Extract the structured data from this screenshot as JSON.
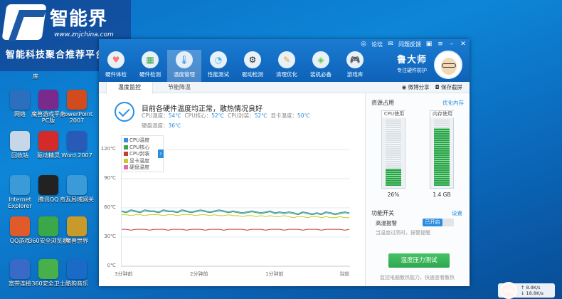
{
  "banner": {
    "brand": "智能界",
    "url": "www.znjchina.com",
    "slogan": "智能科技聚合推荐平台"
  },
  "desktop": {
    "partial_label": "库",
    "icons": [
      {
        "label": "网络",
        "color": "#2d6fbf"
      },
      {
        "label": "魔兽游戏平台PC版",
        "color": "#7a2a8c"
      },
      {
        "label": "PowerPoint 2007",
        "color": "#d24b1e"
      },
      {
        "label": "回收站",
        "color": "#c8d7e8"
      },
      {
        "label": "驱动精灵",
        "color": "#d42a2a"
      },
      {
        "label": "Word 2007",
        "color": "#2a5ab8"
      },
      {
        "label": "Internet Explorer",
        "color": "#3a9bd8"
      },
      {
        "label": "腾讯QQ",
        "color": "#222222"
      },
      {
        "label": "奇瓦局域网关",
        "color": "#3a9bd8"
      },
      {
        "label": "QQ游戏",
        "color": "#e05a2a"
      },
      {
        "label": "360安全浏览器",
        "color": "#3aa848"
      },
      {
        "label": "魔兽世界",
        "color": "#c89a2a"
      },
      {
        "label": "宽带连接",
        "color": "#3a6ac8"
      },
      {
        "label": "360安全卫士",
        "color": "#48b04a"
      },
      {
        "label": "酷狗音乐",
        "color": "#1a6ac8"
      }
    ]
  },
  "window": {
    "topbar": {
      "forum": "论坛",
      "feedback": "问题反馈"
    },
    "nav": [
      {
        "label": "硬件体检",
        "icon": "♥"
      },
      {
        "label": "硬件检测",
        "icon": "▦"
      },
      {
        "label": "温度管理",
        "icon": "🌡"
      },
      {
        "label": "性能测试",
        "icon": "◔"
      },
      {
        "label": "驱动检测",
        "icon": "⚙"
      },
      {
        "label": "清理优化",
        "icon": "✎"
      },
      {
        "label": "装机必备",
        "icon": "◈"
      },
      {
        "label": "游戏库",
        "icon": "🎮"
      }
    ],
    "brand_name": "鲁大师",
    "brand_sub": "专注硬件防护",
    "tabs": {
      "temp_monitor": "温度监控",
      "energy_saving": "节能降温"
    },
    "actions": {
      "share": "微博分享",
      "save_screenshot": "保存截屏"
    },
    "status": {
      "headline": "目前各硬件温度均正常，散热情况良好",
      "cpu_temp_label": "CPU温度：",
      "cpu_temp": "54℃",
      "cpu_core_label": "CPU核心：",
      "cpu_core": "52℃",
      "cpu_package_label": "CPU封装：",
      "cpu_package": "52℃",
      "gpu_temp_label": "显卡温度：",
      "gpu_temp": "50℃",
      "disk_temp_label": "硬盘温度：",
      "disk_temp": "36℃"
    },
    "side": {
      "title": "资源占用",
      "optimize_link": "优化内存",
      "cpu_label": "CPU使用",
      "cpu_value": "26%",
      "cpu_fraction": 0.26,
      "mem_label": "内存使用",
      "mem_value": "1.4 GB",
      "mem_fraction": 0.86,
      "switch_title": "功能开关",
      "settings_link": "设置",
      "alarm_label": "高温报警",
      "alarm_state": "已开启",
      "alarm_desc": "当温度过高时，报警提醒",
      "stress_button": "温度压力测试",
      "footer": "监控电脑散热能力，快速查看散热"
    }
  },
  "chart_data": {
    "type": "line",
    "yticks": [
      "120℃",
      "90℃",
      "60℃",
      "30℃",
      "0℃"
    ],
    "ylim": [
      0,
      120
    ],
    "xticks": [
      "3分钟前",
      "2分钟前",
      "1分钟前",
      "当前"
    ],
    "series": [
      {
        "name": "CPU温度",
        "color": "#3b8bd6",
        "values": [
          57,
          56,
          58,
          57,
          56,
          58,
          57,
          57,
          56,
          58,
          57,
          57,
          56,
          58,
          57,
          56,
          57,
          58,
          57,
          56,
          57,
          58,
          57,
          56,
          57,
          56,
          55,
          56,
          57,
          56,
          55,
          56,
          57,
          55,
          56,
          55,
          56,
          55,
          54,
          56,
          55,
          54,
          55,
          54,
          56,
          55,
          54,
          55,
          56,
          55
        ]
      },
      {
        "name": "CPU核心",
        "color": "#3aa848",
        "values": [
          56,
          55,
          57,
          56,
          55,
          57,
          56,
          56,
          55,
          57,
          56,
          56,
          55,
          57,
          56,
          55,
          56,
          57,
          56,
          55,
          56,
          57,
          56,
          55,
          56,
          55,
          54,
          55,
          56,
          55,
          54,
          55,
          56,
          54,
          55,
          54,
          55,
          54,
          53,
          55,
          54,
          53,
          54,
          53,
          55,
          54,
          53,
          54,
          55,
          54
        ]
      },
      {
        "name": "CPU封装",
        "color": "#c43c3c",
        "values": [
          38,
          38,
          37,
          38,
          38,
          38,
          37,
          38,
          38,
          38,
          37,
          38,
          38,
          38,
          37,
          38,
          38,
          38,
          37,
          38,
          38,
          38,
          37,
          38,
          38,
          38,
          38,
          37,
          38,
          38,
          38,
          37,
          38,
          38,
          38,
          37,
          38,
          38,
          38,
          37,
          38,
          38,
          38,
          37,
          38,
          38,
          38,
          38,
          37,
          38
        ]
      },
      {
        "name": "显卡温度",
        "color": "#c8c82a",
        "values": [
          53,
          53,
          52,
          53,
          53,
          52,
          53,
          53,
          53,
          52,
          53,
          53,
          52,
          53,
          53,
          53,
          52,
          53,
          53,
          52,
          53,
          52,
          52,
          53,
          52,
          52,
          51,
          52,
          52,
          51,
          52,
          51,
          52,
          51,
          51,
          52,
          51,
          50,
          51,
          51,
          50,
          51,
          51,
          50,
          51,
          50,
          50,
          51,
          50,
          50
        ]
      },
      {
        "name": "硬盘温度",
        "color": "#e06aa8",
        "values": []
      }
    ]
  }
}
